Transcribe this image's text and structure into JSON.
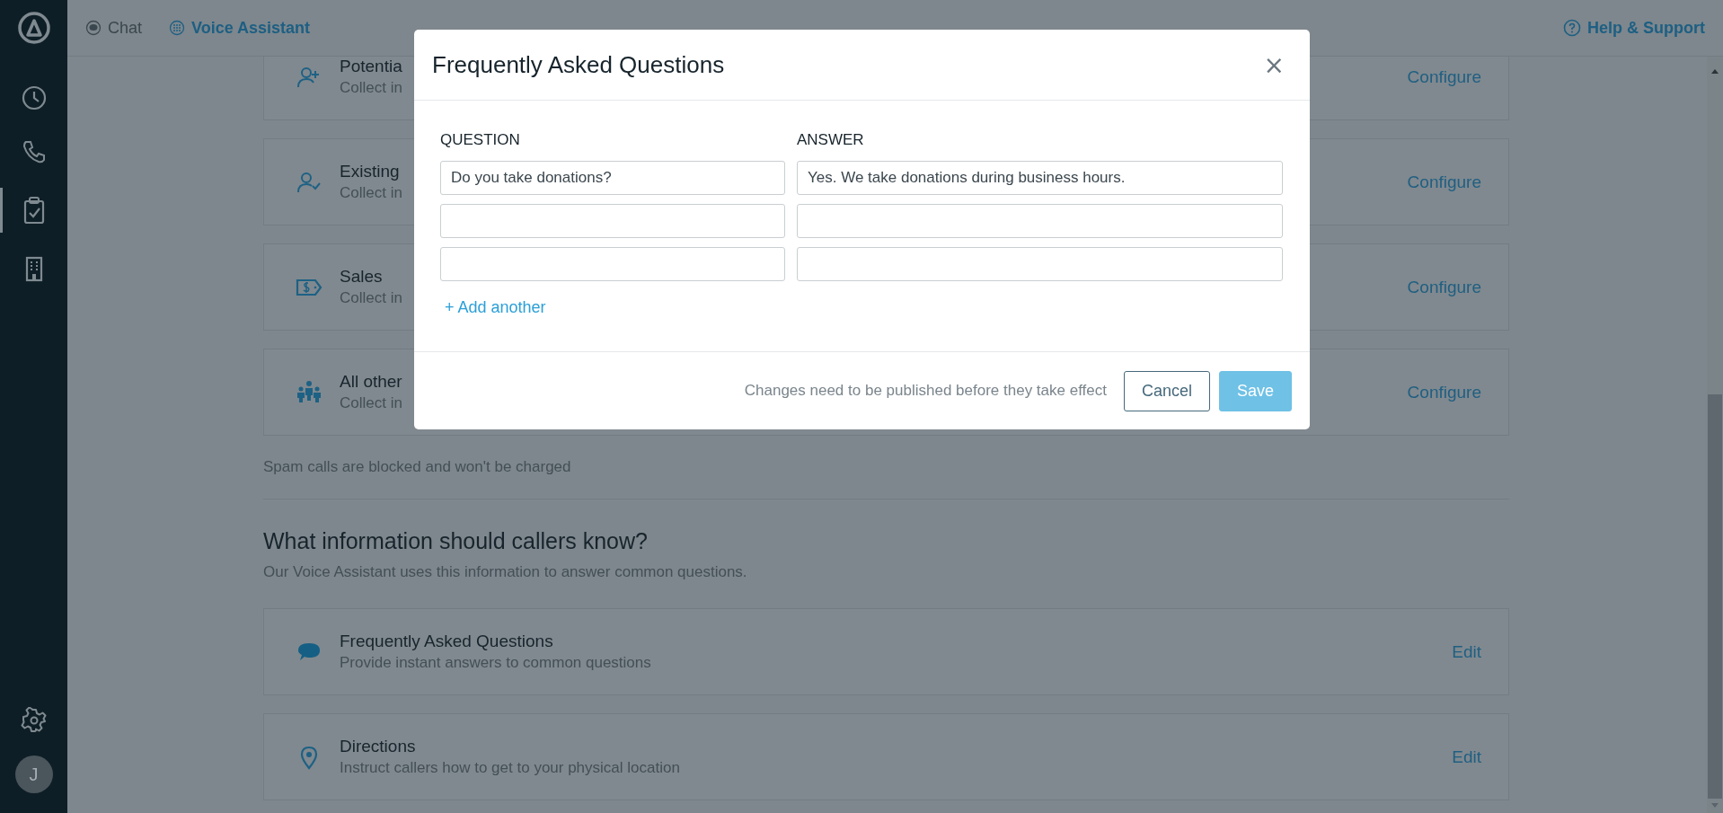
{
  "sidebar": {
    "items": [
      {
        "selected": false
      },
      {
        "selected": false
      },
      {
        "selected": true
      },
      {
        "selected": false
      }
    ],
    "avatar": {
      "initial": "J"
    }
  },
  "top_nav": {
    "tabs": [
      {
        "label": "Chat",
        "selected": false
      },
      {
        "label": "Voice Assistant",
        "selected": true
      }
    ],
    "help_link": "Help & Support"
  },
  "caller_types": [
    {
      "title": "Potentia",
      "subtitle": "Collect in",
      "action": "Configure"
    },
    {
      "title": "Existing",
      "subtitle": "Collect in",
      "action": "Configure"
    },
    {
      "title": "Sales",
      "subtitle": "Collect in",
      "action": "Configure"
    },
    {
      "title": "All other",
      "subtitle": "Collect in",
      "action": "Configure"
    }
  ],
  "spam_note": "Spam calls are blocked and won't be charged",
  "info_section": {
    "heading": "What information should callers know?",
    "description": "Our Voice Assistant uses this information to answer common questions.",
    "items": [
      {
        "title": "Frequently Asked Questions",
        "subtitle": "Provide instant answers to common questions",
        "action": "Edit"
      },
      {
        "title": "Directions",
        "subtitle": "Instruct callers how to get to your physical location",
        "action": "Edit"
      }
    ]
  },
  "modal": {
    "title": "Frequently Asked Questions",
    "close": "×",
    "columns": [
      "QUESTION",
      "ANSWER"
    ],
    "rows": [
      {
        "kind": "filled",
        "question": "Do you take donations?",
        "answer": "Yes. We take donations during business hours."
      },
      {
        "kind": "blank"
      },
      {
        "kind": "blank"
      }
    ],
    "add_link": "+ Add another",
    "footer_note": "Changes need to be published before they take effect",
    "buttons": [
      {
        "label": "Cancel",
        "kind": "secondary",
        "disabled": false
      },
      {
        "label": "Save",
        "kind": "primary",
        "disabled": true
      }
    ]
  }
}
